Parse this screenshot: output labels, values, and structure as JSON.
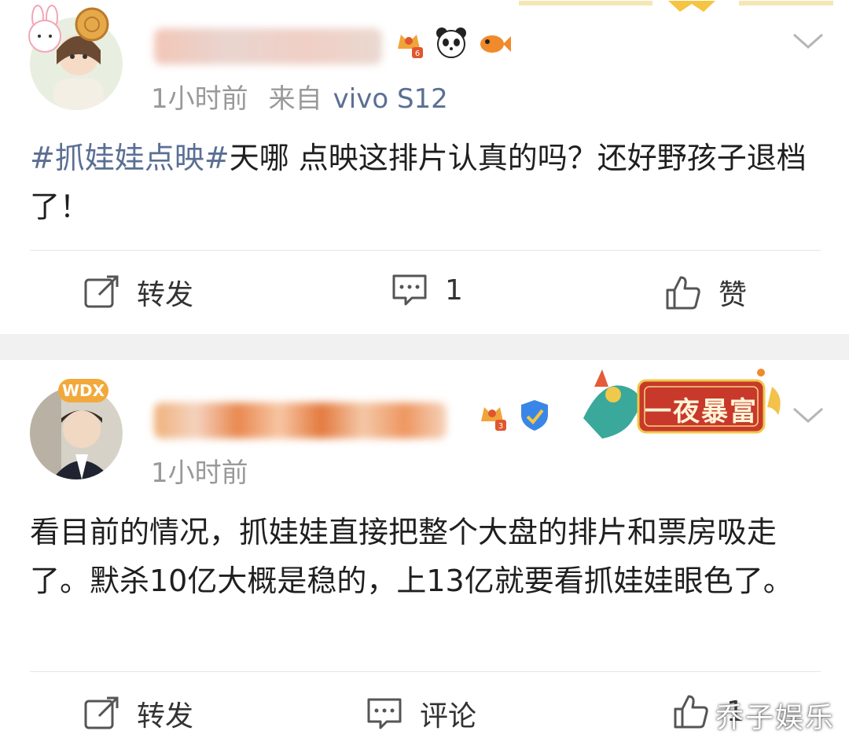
{
  "posts": [
    {
      "avatar": "girl-with-bunny-avatar",
      "badges": [
        "vip-crown-badge-6",
        "panda-badge",
        "goldfish-badge"
      ],
      "time": "1小时前",
      "source_prefix": "来自",
      "device": "vivo S12",
      "hashtag": "#抓娃娃点映#",
      "text": "天哪 点映这排片认真的吗？还好野孩子退档了！",
      "actions": {
        "repost": "转发",
        "comment": "1",
        "like": "赞"
      }
    },
    {
      "avatar": "boy-portrait-avatar",
      "avatar_tag": "WDX",
      "badges": [
        "vip-crown-badge-3",
        "verified-shield-badge"
      ],
      "time": "1小时前",
      "banner": "一夜暴富",
      "text": "看目前的情况，抓娃娃直接把整个大盘的排片和票房吸走了。默杀10亿大概是稳的，上13亿就要看抓娃娃眼色了。",
      "actions": {
        "repost": "转发",
        "comment": "评论",
        "like": "1"
      }
    }
  ],
  "watermark": "乔子娱乐",
  "colors": {
    "link": "#5b6f94",
    "meta": "#999999",
    "divider": "#e5e5e5",
    "gap": "#f1f1f1",
    "banner_red": "#c8392b"
  }
}
